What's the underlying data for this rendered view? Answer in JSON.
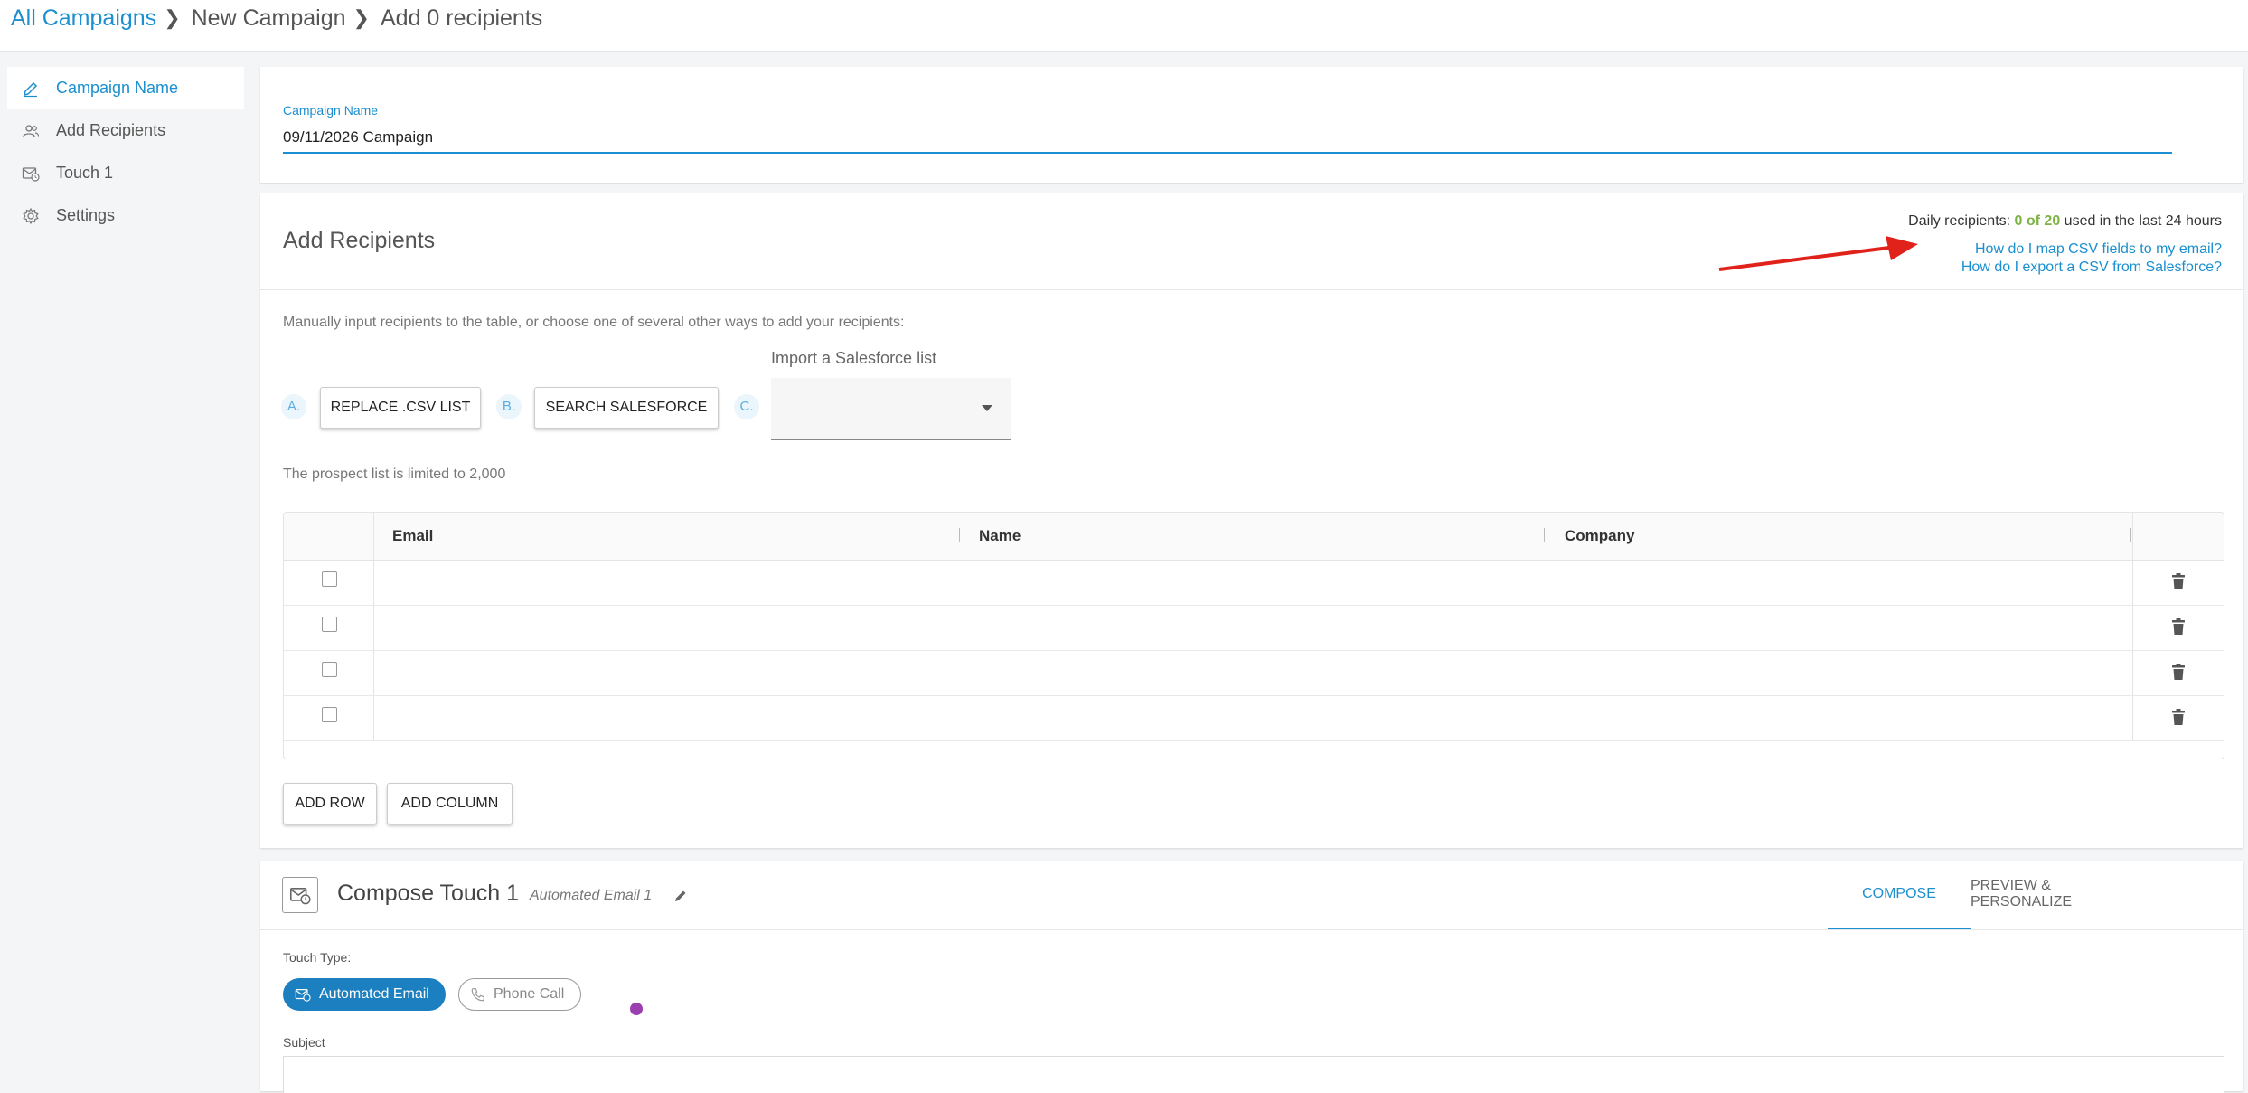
{
  "breadcrumb": {
    "items": [
      {
        "label": "All Campaigns"
      },
      {
        "label": "New Campaign"
      },
      {
        "label": "Add 0 recipients"
      }
    ],
    "separator": "❯"
  },
  "sidebar": {
    "items": [
      {
        "label": "Campaign Name",
        "icon": "pencil-icon",
        "active": true
      },
      {
        "label": "Add Recipients",
        "icon": "people-icon",
        "active": false
      },
      {
        "label": "Touch 1",
        "icon": "mail-clock-icon",
        "active": false
      },
      {
        "label": "Settings",
        "icon": "gear-icon",
        "active": false
      }
    ]
  },
  "campaign_name": {
    "label": "Campaign Name",
    "value": "09/11/2026 Campaign"
  },
  "recipients": {
    "title": "Add Recipients",
    "daily_prefix": "Daily recipients: ",
    "daily_count": "0 of 20",
    "daily_suffix": " used in the last 24 hours",
    "help_csv": "How do I map CSV fields to my email?",
    "help_salesforce": "How do I export a CSV from Salesforce?",
    "intro": "Manually input recipients to the table, or choose one of several other ways to add your recipients:",
    "steps": {
      "a": "A.",
      "b": "B.",
      "c": "C."
    },
    "replace_csv": "REPLACE .CSV LIST",
    "search_salesforce": "SEARCH SALESFORCE",
    "import_label": "Import a Salesforce list",
    "import_value": "",
    "limit_note": "The prospect list is limited to 2,000",
    "table": {
      "columns": [
        "Email",
        "Name",
        "Company"
      ],
      "rows": [
        {
          "email": "",
          "name": "",
          "company": ""
        },
        {
          "email": "",
          "name": "",
          "company": ""
        },
        {
          "email": "",
          "name": "",
          "company": ""
        },
        {
          "email": "",
          "name": "",
          "company": ""
        }
      ]
    },
    "add_row": "ADD ROW",
    "add_column": "ADD COLUMN"
  },
  "compose": {
    "title": "Compose Touch 1",
    "subtitle": "Automated Email 1",
    "tabs": [
      "COMPOSE",
      "PREVIEW & PERSONALIZE"
    ],
    "touch_type_label": "Touch Type:",
    "touch_types": [
      "Automated Email",
      "Phone Call"
    ],
    "subject_label": "Subject",
    "subject_value": ""
  },
  "colors": {
    "accent": "#1b8fcf",
    "highlight_green": "#7cb342",
    "arrow_red": "#e0221b",
    "cursor_dot": "#9b3fb0"
  }
}
